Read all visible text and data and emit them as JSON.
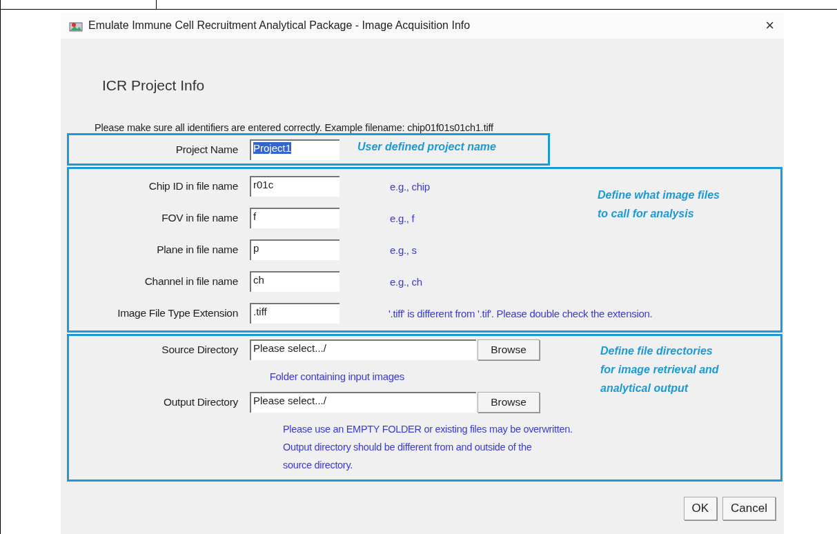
{
  "window": {
    "title": "Emulate Immune Cell Recruitment Analytical Package - Image Acquisition Info",
    "close": "×"
  },
  "heading": "ICR Project Info",
  "instruction": "Please make sure all identifiers are entered correctly. Example filename: chip01f01s01ch1.tiff",
  "project": {
    "label": "Project Name",
    "value": "Project1",
    "text_selected": true,
    "annotation": "User defined project name"
  },
  "identifiers": {
    "annotation": "Define what image files\nto call for analysis",
    "rows": [
      {
        "label": "Chip ID in file name",
        "value": "r01c",
        "hint": "e.g., chip"
      },
      {
        "label": "FOV in file name",
        "value": "f",
        "hint": "e.g., f"
      },
      {
        "label": "Plane in file name",
        "value": "p",
        "hint": "e.g., s"
      },
      {
        "label": "Channel in file name",
        "value": "ch",
        "hint": "e.g., ch"
      },
      {
        "label": "Image File Type Extension",
        "value": ".tiff",
        "hint": "'.tiff' is different from '.tif'. Please double check the extension."
      }
    ]
  },
  "directories": {
    "annotation": "Define file directories\nfor image retrieval and\nanalytical output",
    "source": {
      "label": "Source Directory",
      "value": "Please select.../",
      "button": "Browse",
      "note": "Folder containing input images"
    },
    "output": {
      "label": "Output Directory",
      "value": "Please select.../",
      "button": "Browse"
    },
    "warning": "Please use an EMPTY FOLDER or existing files may be overwritten.\nOutput directory should be different from and outside of the\nsource directory."
  },
  "buttons": [
    "OK",
    "Cancel"
  ]
}
